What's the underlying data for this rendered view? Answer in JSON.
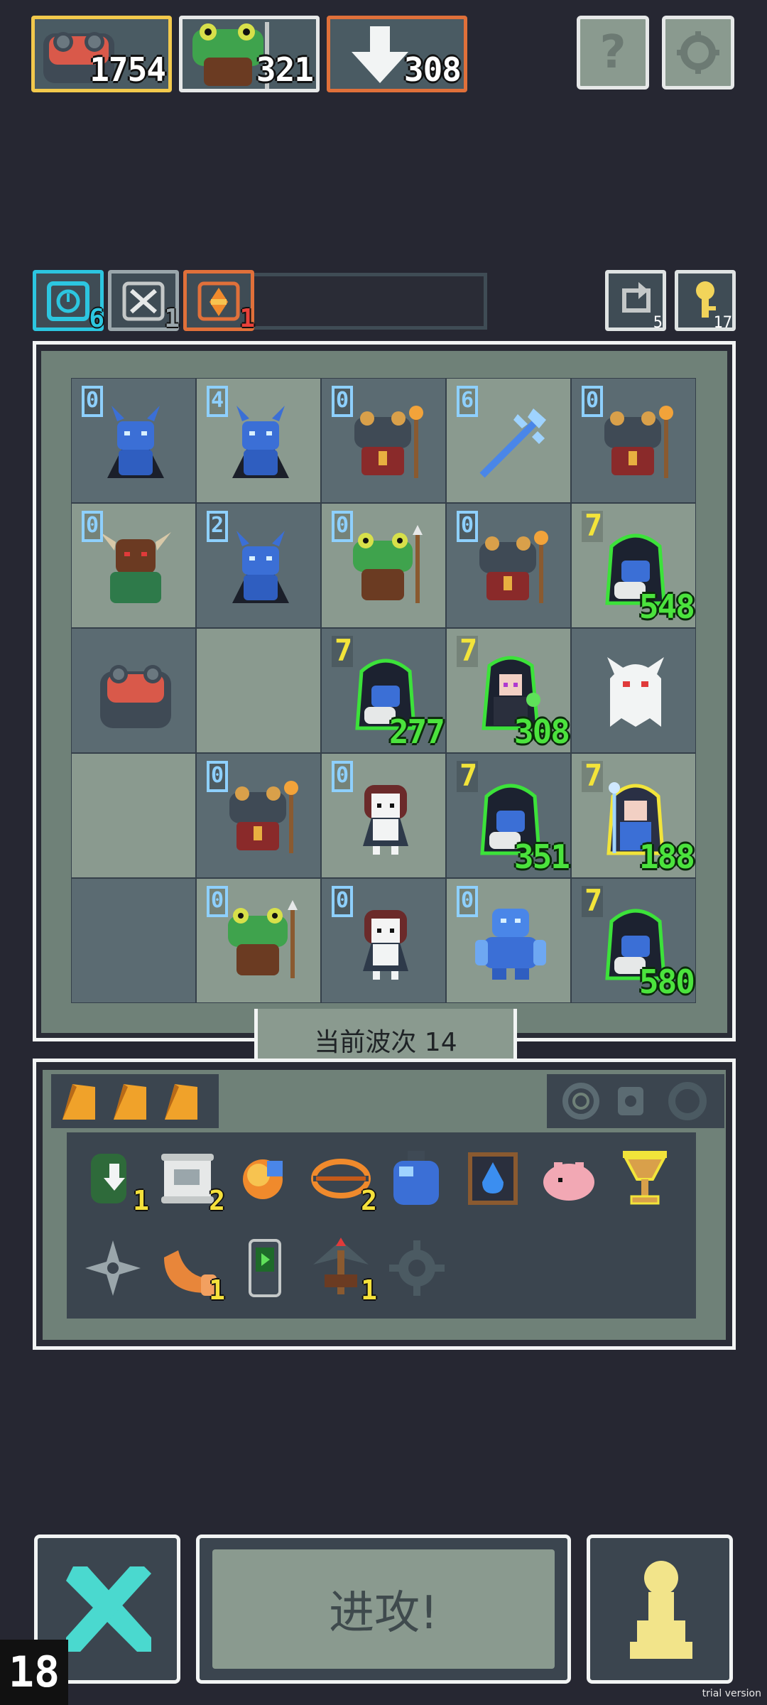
{
  "top": {
    "resources": [
      {
        "name": "red-frog",
        "value": "1754",
        "border": "#f2c94c"
      },
      {
        "name": "green-frog",
        "value": "321",
        "border": "#e6e8e8"
      },
      {
        "name": "down-arrow-unit",
        "value": "308",
        "border": "#e0703a"
      }
    ],
    "help_label": "?",
    "settings_icon": "gear-icon"
  },
  "status": {
    "clock": {
      "count": "6",
      "color": "#2cc6e0"
    },
    "swords": {
      "count": "1",
      "color": "#9aa6ab"
    },
    "fire": {
      "count": "1",
      "color": "#e0703a"
    },
    "refresh": {
      "count": "5"
    },
    "key": {
      "count": "17"
    }
  },
  "board": {
    "cells": [
      {
        "shade": "dark",
        "lvl": "0",
        "lvlColor": "blue",
        "unit": "blue-demon"
      },
      {
        "shade": "light",
        "lvl": "4",
        "lvlColor": "blue",
        "unit": "blue-demon"
      },
      {
        "shade": "dark",
        "lvl": "0",
        "lvlColor": "blue",
        "unit": "grey-frog-mage"
      },
      {
        "shade": "light",
        "lvl": "6",
        "lvlColor": "blue",
        "unit": "ice-trident"
      },
      {
        "shade": "dark",
        "lvl": "0",
        "lvlColor": "blue",
        "unit": "grey-frog-mage"
      },
      {
        "shade": "light",
        "lvl": "0",
        "lvlColor": "blue",
        "unit": "minotaur"
      },
      {
        "shade": "dark",
        "lvl": "2",
        "lvlColor": "blue",
        "unit": "blue-demon"
      },
      {
        "shade": "light",
        "lvl": "0",
        "lvlColor": "blue",
        "unit": "green-frog-spear"
      },
      {
        "shade": "dark",
        "lvl": "0",
        "lvlColor": "blue",
        "unit": "grey-frog-mage"
      },
      {
        "shade": "light",
        "lvl": "7",
        "lvlColor": "yellow",
        "unit": "hooded-reaper",
        "hp": "548"
      },
      {
        "shade": "dark",
        "lvl": "",
        "lvlColor": "blue",
        "unit": "red-frog"
      },
      {
        "shade": "light",
        "lvl": "",
        "lvlColor": "blue",
        "unit": ""
      },
      {
        "shade": "dark",
        "lvl": "7",
        "lvlColor": "yellow",
        "unit": "hooded-reaper",
        "hp": "277"
      },
      {
        "shade": "light",
        "lvl": "7",
        "lvlColor": "yellow",
        "unit": "witch-girl",
        "hp": "308"
      },
      {
        "shade": "dark",
        "lvl": "",
        "lvlColor": "blue",
        "unit": "white-ghost"
      },
      {
        "shade": "light",
        "lvl": "",
        "lvlColor": "blue",
        "unit": ""
      },
      {
        "shade": "dark",
        "lvl": "0",
        "lvlColor": "blue",
        "unit": "grey-frog-mage"
      },
      {
        "shade": "light",
        "lvl": "0",
        "lvlColor": "blue",
        "unit": "maid-girl"
      },
      {
        "shade": "dark",
        "lvl": "7",
        "lvlColor": "yellow",
        "unit": "hooded-reaper",
        "hp": "351"
      },
      {
        "shade": "light",
        "lvl": "7",
        "lvlColor": "yellow",
        "unit": "ice-mage-girl",
        "hp": "188"
      },
      {
        "shade": "dark",
        "lvl": "",
        "lvlColor": "blue",
        "unit": ""
      },
      {
        "shade": "light",
        "lvl": "0",
        "lvlColor": "blue",
        "unit": "green-frog-spear"
      },
      {
        "shade": "dark",
        "lvl": "0",
        "lvlColor": "blue",
        "unit": "maid-girl"
      },
      {
        "shade": "light",
        "lvl": "0",
        "lvlColor": "blue",
        "unit": "ice-golem"
      },
      {
        "shade": "dark",
        "lvl": "7",
        "lvlColor": "yellow",
        "unit": "hooded-reaper",
        "hp": "580"
      }
    ],
    "wave_label": "当前波次 14"
  },
  "relics": {
    "row1": [
      {
        "name": "green-arrow-spirit",
        "count": "1"
      },
      {
        "name": "scroll",
        "count": "2"
      },
      {
        "name": "flame-shell",
        "count": ""
      },
      {
        "name": "orange-ring",
        "count": "2"
      },
      {
        "name": "blue-potion",
        "count": ""
      },
      {
        "name": "water-book",
        "count": ""
      },
      {
        "name": "pink-pig",
        "count": ""
      },
      {
        "name": "golden-trophy",
        "count": ""
      }
    ],
    "row2": [
      {
        "name": "shuriken",
        "count": ""
      },
      {
        "name": "horn",
        "count": "1"
      },
      {
        "name": "phone",
        "count": ""
      },
      {
        "name": "crossbow",
        "count": "1"
      },
      {
        "name": "cog",
        "count": ""
      }
    ]
  },
  "bottom": {
    "attack_label": "进攻!",
    "turn_count": "18",
    "trial_label": "trial version"
  }
}
